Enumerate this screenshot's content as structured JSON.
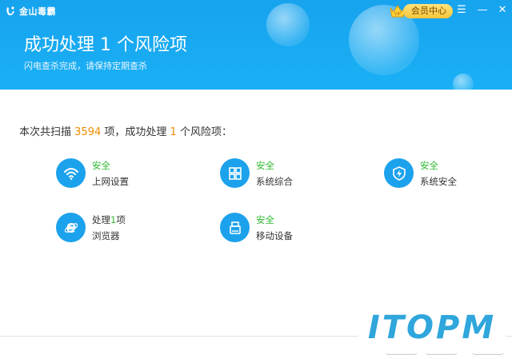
{
  "app": {
    "name": "金山毒霸"
  },
  "header": {
    "vip_label": "会员中心",
    "controls": {
      "menu": "☰",
      "minimize": "—",
      "close": "✕"
    },
    "title": "成功处理 1 个风险项",
    "subtitle": "闪电查杀完成，请保持定期查杀"
  },
  "summary": {
    "prefix": "本次共扫描",
    "scanned_count": "3594",
    "middle": "项，成功处理",
    "handled_count": "1",
    "suffix": "个风险项："
  },
  "items": [
    {
      "status": "安全",
      "label": "上网设置",
      "icon": "wifi-icon"
    },
    {
      "status": "安全",
      "label": "系统综合",
      "icon": "windows-grid-icon"
    },
    {
      "status": "安全",
      "label": "系统安全",
      "icon": "shield-lightning-icon"
    },
    {
      "status_prefix": "处理",
      "status_count": "1",
      "status_suffix": "项",
      "label": "浏览器",
      "icon": "browser-e-icon"
    },
    {
      "status": "安全",
      "label": "移动设备",
      "icon": "usb-drive-icon"
    }
  ],
  "watermark": "ITOPM",
  "colors": {
    "header_blue": "#1aa9f2",
    "icon_blue": "#1ca2ec",
    "safe_green": "#2db82d",
    "count_orange": "#f08a00",
    "vip_gold": "#f8c63b"
  }
}
